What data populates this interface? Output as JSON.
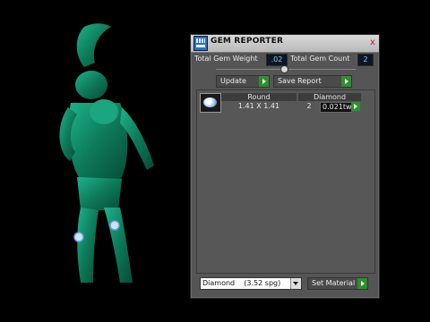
{
  "panel": {
    "title": "GEM REPORTER",
    "close_glyph": "x",
    "total_weight_label": "Total Gem Weight",
    "total_weight_value": ".02",
    "total_count_label": "Total Gem Count",
    "total_count_value": "2",
    "update_label": "Update",
    "save_report_label": "Save Report",
    "list": {
      "columns": [
        "Round",
        "Diamond"
      ],
      "rows": [
        {
          "size": "1.41 X 1.41",
          "count": "2",
          "weight": "0.021tw"
        }
      ]
    },
    "material_select_value": "Diamond    (3.52 spg)",
    "set_material_label": "Set Material"
  },
  "icons": {
    "logo": "gem-reporter-logo-icon",
    "close": "close-icon",
    "go": "go-arrow-icon",
    "thumb": "round-gem-thumbnail-icon",
    "dropdown": "chevron-down-icon"
  },
  "colors": {
    "figure": "#0e7a5a",
    "panel_bg": "#555555",
    "value_text": "#7fd3ff",
    "go_button": "#2f8f2f",
    "close_x": "#c02020"
  }
}
